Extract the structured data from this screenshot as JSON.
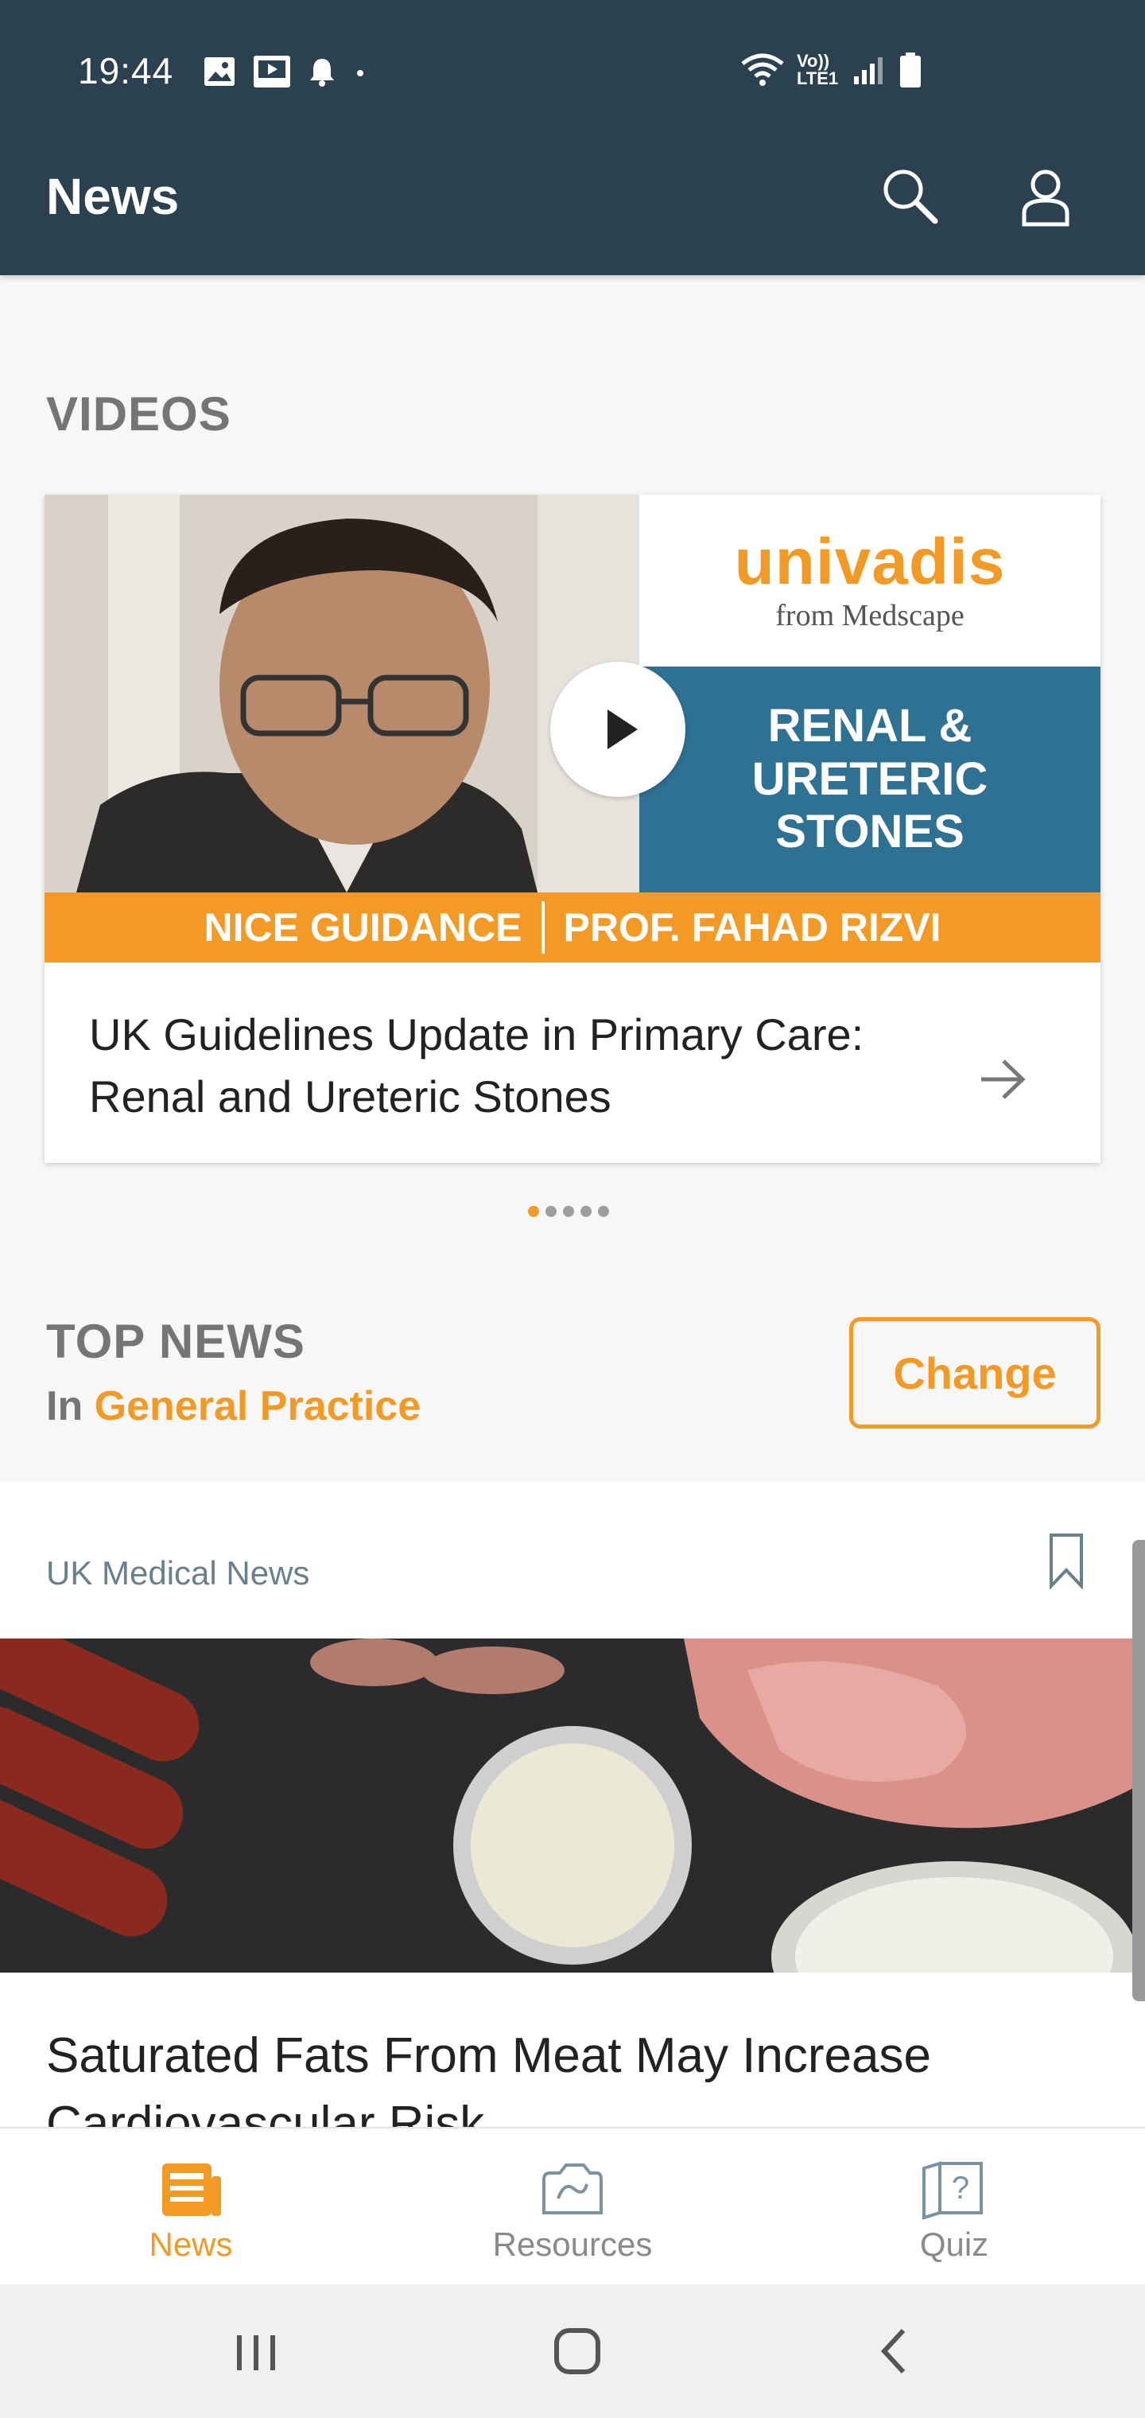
{
  "status_bar": {
    "time": "19:44",
    "left_icons": [
      "image-icon",
      "video-icon",
      "bell-icon",
      "dot-icon"
    ],
    "right_icons": [
      "wifi-icon",
      "volte-icon",
      "signal-icon",
      "battery-icon"
    ],
    "volte_text": "Vo)) LTE1"
  },
  "app_bar": {
    "title": "News",
    "icons": [
      "search-icon",
      "profile-icon"
    ]
  },
  "videos": {
    "section_title": "VIDEOS",
    "card": {
      "brand_name": "univadis",
      "brand_from": "from Medscape",
      "topic_text": "RENAL & URETERIC STONES",
      "banner_left": "NICE GUIDANCE",
      "banner_right": "PROF. FAHAD RIZVI",
      "caption": "UK Guidelines Update in Primary Care: Renal and Ureteric Stones"
    },
    "pager": {
      "count": 5,
      "active_index": 0
    }
  },
  "top_news": {
    "title": "TOP NEWS",
    "in_label": "In",
    "category": "General Practice",
    "change_label": "Change"
  },
  "news_item": {
    "source": "UK Medical News",
    "headline": "Saturated Fats From Meat May Increase Cardiovascular Risk"
  },
  "bottom_nav": [
    {
      "label": "News",
      "icon": "news-icon",
      "active": true
    },
    {
      "label": "Resources",
      "icon": "resources-icon",
      "active": false
    },
    {
      "label": "Quiz",
      "icon": "quiz-icon",
      "active": false
    }
  ],
  "colors": {
    "header": "#2b4150",
    "accent": "#f39a26",
    "topic_blue": "#2e7192",
    "muted_text": "#757575"
  }
}
